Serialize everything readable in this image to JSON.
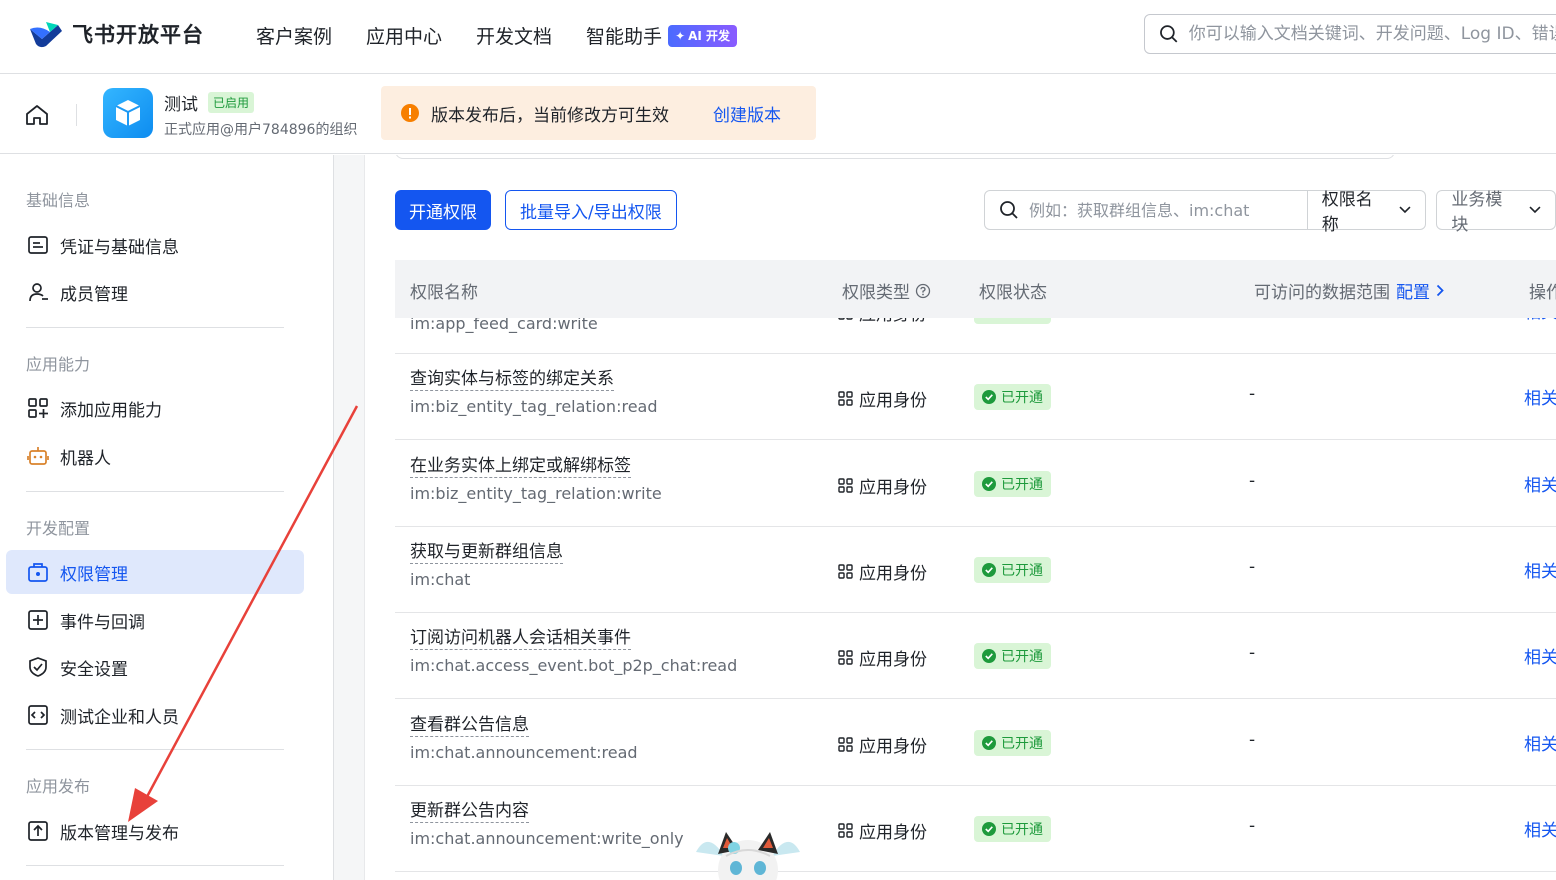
{
  "brand": {
    "name": "飞书开放平台"
  },
  "nav": {
    "items": [
      "客户案例",
      "应用中心",
      "开发文档",
      "智能助手"
    ],
    "ai_badge": "AI 开发"
  },
  "top_search": {
    "placeholder": "你可以输入文档关键词、开发问题、Log ID、错误码"
  },
  "app": {
    "name": "测试",
    "status": "已启用",
    "org": "正式应用@用户784896的组织"
  },
  "notice": {
    "text": "版本发布后，当前修改方可生效",
    "link": "创建版本"
  },
  "sidebar": {
    "groups": [
      {
        "title": "基础信息",
        "items": [
          {
            "label": "凭证与基础信息",
            "icon": "credential-icon"
          },
          {
            "label": "成员管理",
            "icon": "user-icon"
          }
        ]
      },
      {
        "title": "应用能力",
        "items": [
          {
            "label": "添加应用能力",
            "icon": "apps-add-icon"
          },
          {
            "label": "机器人",
            "icon": "robot-icon"
          }
        ]
      },
      {
        "title": "开发配置",
        "items": [
          {
            "label": "权限管理",
            "icon": "permission-icon",
            "active": true
          },
          {
            "label": "事件与回调",
            "icon": "event-icon"
          },
          {
            "label": "安全设置",
            "icon": "shield-icon"
          },
          {
            "label": "测试企业和人员",
            "icon": "test-icon"
          }
        ]
      },
      {
        "title": "应用发布",
        "items": [
          {
            "label": "版本管理与发布",
            "icon": "upload-icon"
          }
        ]
      }
    ]
  },
  "toolbar": {
    "primary": "开通权限",
    "secondary": "批量导入/导出权限",
    "search_placeholder": "例如：获取群组信息、im:chat",
    "select1": "权限名称",
    "select2": "业务模块"
  },
  "table": {
    "headers": {
      "name": "权限名称",
      "type": "权限类型",
      "status": "权限状态",
      "range": "可访问的数据范围",
      "range_link": "配置",
      "op": "操作"
    },
    "rows": [
      {
        "title": "",
        "key": "im:app_feed_card:write",
        "type": "应用身份",
        "status": "已开通",
        "range": "-",
        "op": "相关API"
      },
      {
        "title": "查询实体与标签的绑定关系",
        "key": "im:biz_entity_tag_relation:read",
        "type": "应用身份",
        "status": "已开通",
        "range": "-",
        "op": "相关API"
      },
      {
        "title": "在业务实体上绑定或解绑标签",
        "key": "im:biz_entity_tag_relation:write",
        "type": "应用身份",
        "status": "已开通",
        "range": "-",
        "op": "相关API"
      },
      {
        "title": "获取与更新群组信息",
        "key": "im:chat",
        "type": "应用身份",
        "status": "已开通",
        "range": "-",
        "op": "相关API"
      },
      {
        "title": "订阅访问机器人会话相关事件",
        "key": "im:chat.access_event.bot_p2p_chat:read",
        "type": "应用身份",
        "status": "已开通",
        "range": "-",
        "op": "相关API"
      },
      {
        "title": "查看群公告信息",
        "key": "im:chat.announcement:read",
        "type": "应用身份",
        "status": "已开通",
        "range": "-",
        "op": "相关API"
      },
      {
        "title": "更新群公告内容",
        "key": "im:chat.announcement:write_only",
        "type": "应用身份",
        "status": "已开通",
        "range": "-",
        "op": "相关API"
      }
    ]
  },
  "colors": {
    "accent": "#1456f0",
    "success": "#1e9a3c",
    "annotation": "#e8413a"
  }
}
